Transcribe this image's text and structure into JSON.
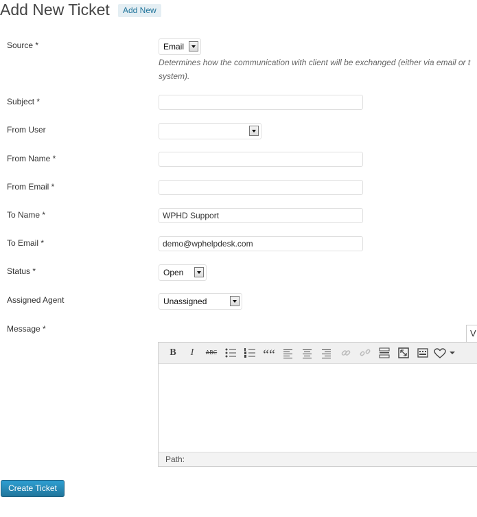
{
  "header": {
    "title": "Add New Ticket",
    "add_new_label": "Add New"
  },
  "form": {
    "source": {
      "label": "Source  *",
      "value": "Email",
      "description": "Determines how the communication with client will be exchanged (either via email or t system)."
    },
    "subject": {
      "label": "Subject  *",
      "value": ""
    },
    "from_user": {
      "label": "From User",
      "value": ""
    },
    "from_name": {
      "label": "From Name  *",
      "value": ""
    },
    "from_email": {
      "label": "From Email  *",
      "value": ""
    },
    "to_name": {
      "label": "To Name  *",
      "value": "WPHD Support"
    },
    "to_email": {
      "label": "To Email  *",
      "value": "demo@wphelpdesk.com"
    },
    "status": {
      "label": "Status  *",
      "value": "Open"
    },
    "assigned_agent": {
      "label": "Assigned Agent",
      "value": "Unassigned"
    },
    "message": {
      "label": "Message  *",
      "visual_tab": "V",
      "path_label": "Path:"
    }
  },
  "editor_toolbar": {
    "bold": "B",
    "italic": "I",
    "strikethrough": "ABC",
    "blockquote": "““"
  },
  "icons": [
    "bold-icon",
    "italic-icon",
    "strikethrough-icon",
    "bullet-list-icon",
    "numbered-list-icon",
    "blockquote-icon",
    "align-left-icon",
    "align-center-icon",
    "align-right-icon",
    "link-icon",
    "unlink-icon",
    "more-tag-icon",
    "fullscreen-icon",
    "kitchen-sink-icon",
    "heart-icon",
    "chevron-down-icon"
  ],
  "actions": {
    "create_label": "Create Ticket"
  },
  "colors": {
    "accent": "#21759b",
    "add_new_bg": "#e4eef3",
    "button": "#2e9fd2"
  }
}
